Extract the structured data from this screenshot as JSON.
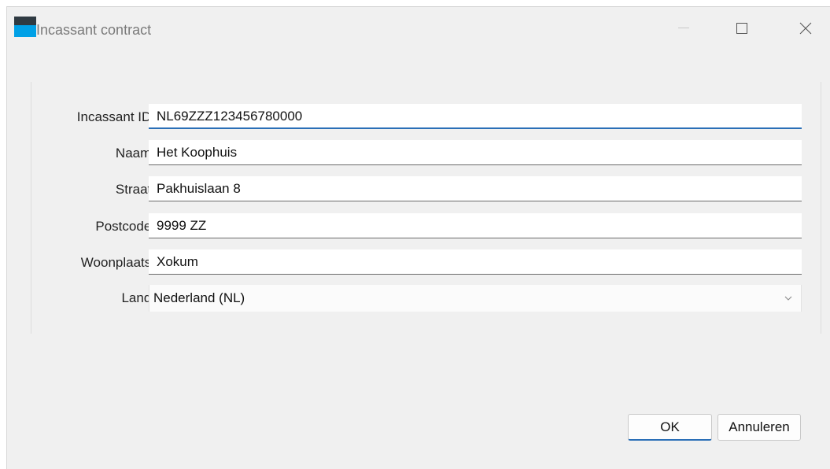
{
  "window": {
    "title": "Incassant contract"
  },
  "form": {
    "fields": [
      {
        "label": "Incassant ID:",
        "value": "NL69ZZZ123456780000"
      },
      {
        "label": "Naam:",
        "value": "Het Koophuis"
      },
      {
        "label": "Straat:",
        "value": "Pakhuislaan 8"
      },
      {
        "label": "Postcode:",
        "value": "9999 ZZ"
      },
      {
        "label": "Woonplaats:",
        "value": "Xokum"
      }
    ],
    "country": {
      "label": "Land:",
      "selected": "Nederland (NL)"
    }
  },
  "buttons": {
    "ok": "OK",
    "cancel": "Annuleren"
  },
  "colors": {
    "accent": "#2a6fb7",
    "icon_dark": "#2f3a42",
    "icon_blue": "#00a0e6"
  }
}
